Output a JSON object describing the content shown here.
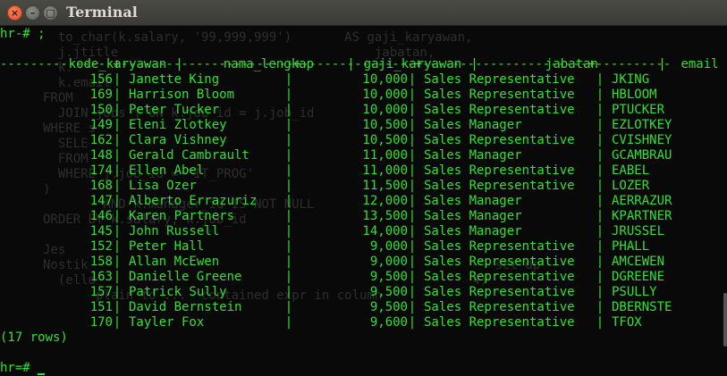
{
  "window": {
    "title": "Terminal"
  },
  "buttons": {
    "close": "×",
    "minimize": "–",
    "maximize": "□"
  },
  "ghost_lines": [
    "  to_char(k.salary, '99,999,999')       AS gaji_karyawan,",
    "  j.jtitle                                  jabatan,",
    "  k.",
    "  k.email",
    "FROM",
    "  JOIN jobs j ON k.job_id = j.job_id",
    "WHERE s",
    "  SELE",
    "  FROM",
    "  WHERE j.job_id = 'IT_PROG'",
    ")",
    "        AND k.manager_id IS NOT NULL",
    "ORDER BY k.salary, k.job_id",
    "",
    "Jes",
    "Nostik                                                      set dp",
    "  (ello                                                  4)",
    "       plain to ...  contained expr in column"
  ],
  "prompt_top": "hr-# ;",
  "table": {
    "headers": [
      "kode_karyawan",
      "nama_lengkap",
      "gaji_karyawan",
      "jabatan",
      "email"
    ],
    "divider": "---------------+-----------------------+---------------+----------------------+----------",
    "rows": [
      [
        "156",
        "Janette King",
        "10,000",
        "Sales Representative",
        "JKING"
      ],
      [
        "169",
        "Harrison Bloom",
        "10,000",
        "Sales Representative",
        "HBLOOM"
      ],
      [
        "150",
        "Peter Tucker",
        "10,000",
        "Sales Representative",
        "PTUCKER"
      ],
      [
        "149",
        "Eleni Zlotkey",
        "10,500",
        "Sales Manager",
        "EZLOTKEY"
      ],
      [
        "162",
        "Clara Vishney",
        "10,500",
        "Sales Representative",
        "CVISHNEY"
      ],
      [
        "148",
        "Gerald Cambrault",
        "11,000",
        "Sales Manager",
        "GCAMBRAU"
      ],
      [
        "174",
        "Ellen Abel",
        "11,000",
        "Sales Representative",
        "EABEL"
      ],
      [
        "168",
        "Lisa Ozer",
        "11,500",
        "Sales Representative",
        "LOZER"
      ],
      [
        "147",
        "Alberto Errazuriz",
        "12,000",
        "Sales Manager",
        "AERRAZUR"
      ],
      [
        "146",
        "Karen Partners",
        "13,500",
        "Sales Manager",
        "KPARTNER"
      ],
      [
        "145",
        "John Russell",
        "14,000",
        "Sales Manager",
        "JRUSSEL"
      ],
      [
        "152",
        "Peter Hall",
        "9,000",
        "Sales Representative",
        "PHALL"
      ],
      [
        "158",
        "Allan McEwen",
        "9,000",
        "Sales Representative",
        "AMCEWEN"
      ],
      [
        "163",
        "Danielle Greene",
        "9,500",
        "Sales Representative",
        "DGREENE"
      ],
      [
        "157",
        "Patrick Sully",
        "9,500",
        "Sales Representative",
        "PSULLY"
      ],
      [
        "151",
        "David Bernstein",
        "9,500",
        "Sales Representative",
        "DBERNSTE"
      ],
      [
        "170",
        "Tayler Fox",
        "9,600",
        "Sales Representative",
        "TFOX"
      ]
    ]
  },
  "row_count": "(17 rows)",
  "prompt_bottom": "hr=# "
}
